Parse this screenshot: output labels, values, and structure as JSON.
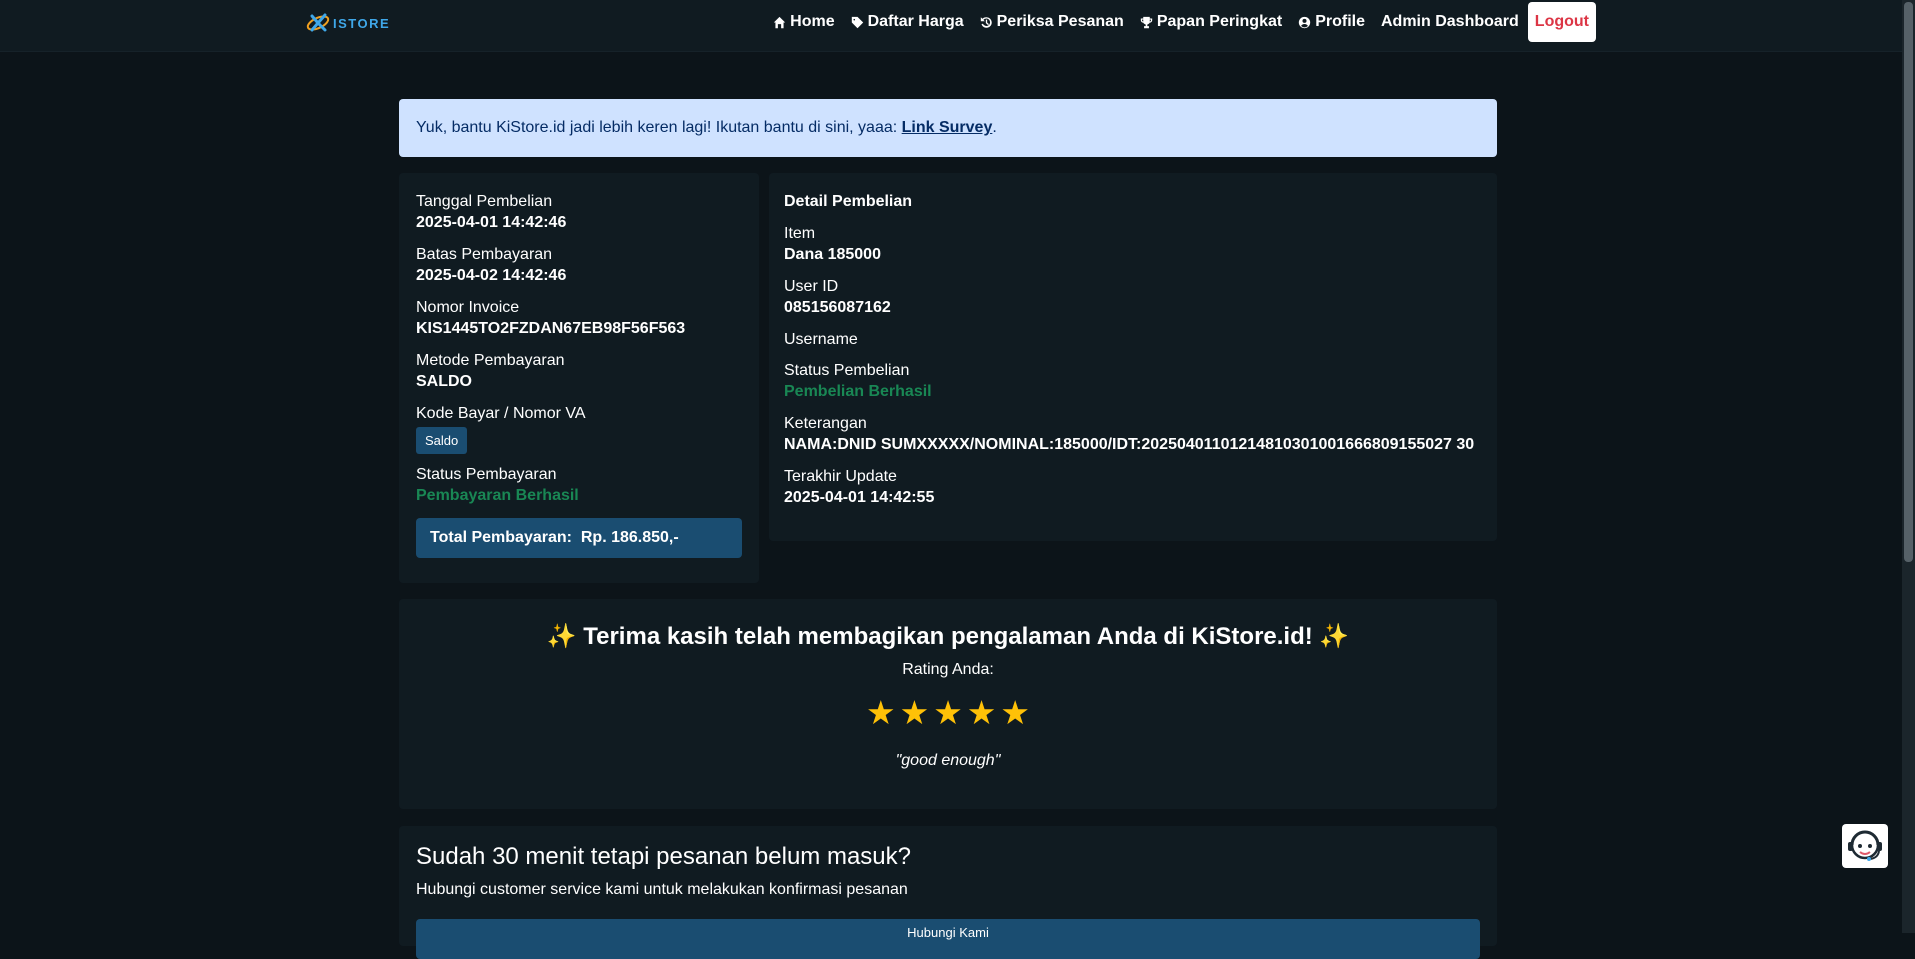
{
  "nav": {
    "logo_text": "ISTORE",
    "items": [
      {
        "label": "Home",
        "icon": "home-icon"
      },
      {
        "label": "Daftar Harga",
        "icon": "tag-icon"
      },
      {
        "label": "Periksa Pesanan",
        "icon": "history-icon"
      },
      {
        "label": "Papan Peringkat",
        "icon": "trophy-icon"
      },
      {
        "label": "Profile",
        "icon": "user-circle-icon"
      },
      {
        "label": "Admin Dashboard",
        "icon": ""
      }
    ],
    "logout_label": "Logout"
  },
  "alert": {
    "text": "Yuk, bantu KiStore.id jadi lebih keren lagi! Ikutan bantu di sini, yaaa: ",
    "link_label": "Link Survey",
    "suffix": "."
  },
  "payment": {
    "purchase_date_label": "Tanggal Pembelian",
    "purchase_date": "2025-04-01 14:42:46",
    "deadline_label": "Batas Pembayaran",
    "deadline": "2025-04-02 14:42:46",
    "invoice_label": "Nomor Invoice",
    "invoice": "KIS1445TO2FZDAN67EB98F56F563",
    "method_label": "Metode Pembayaran",
    "method": "SALDO",
    "code_label": "Kode Bayar / Nomor VA",
    "code_badge": "Saldo",
    "status_label": "Status Pembayaran",
    "status": "Pembayaran Berhasil",
    "total_label": "Total Pembayaran:",
    "total_value": "Rp. 186.850,-"
  },
  "detail": {
    "heading": "Detail Pembelian",
    "item_label": "Item",
    "item": "Dana 185000",
    "userid_label": "User ID",
    "userid": "085156087162",
    "username_label": "Username",
    "username": "",
    "status_label": "Status Pembelian",
    "status": "Pembelian Berhasil",
    "note_label": "Keterangan",
    "note": "NAMA:DNID SUMXXXXX/NOMINAL:185000/IDT:20250401101214810301001666809155027 30",
    "updated_label": "Terakhir Update",
    "updated": "2025-04-01 14:42:55"
  },
  "rating": {
    "title": "✨ Terima kasih telah membagikan pengalaman Anda di KiStore.id! ✨",
    "subtitle": "Rating Anda:",
    "stars": 5,
    "review": "\"good enough\""
  },
  "help": {
    "title": "Sudah 30 menit tetapi pesanan belum masuk?",
    "subtitle": "Hubungi customer service kami untuk melakukan konfirmasi pesanan",
    "button_label": "Hubungi Kami"
  },
  "colors": {
    "accent": "#1a4d71",
    "success": "#198754",
    "star": "#ffc107",
    "danger": "#dc3545"
  }
}
